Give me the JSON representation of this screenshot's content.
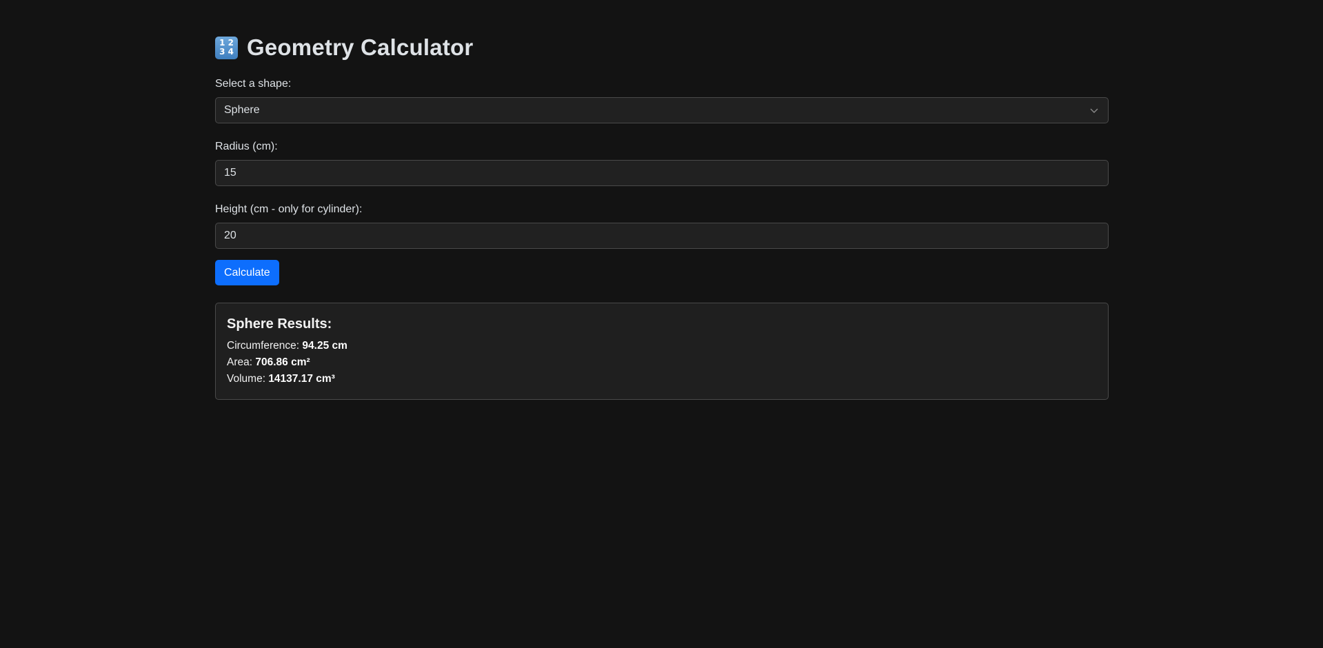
{
  "header": {
    "icon_digits": [
      "1",
      "2",
      "3",
      "4"
    ],
    "title": "Geometry Calculator"
  },
  "form": {
    "shape_label": "Select a shape:",
    "shape_selected": "Sphere",
    "radius_label": "Radius (cm):",
    "radius_value": "15",
    "height_label": "Height (cm - only for cylinder):",
    "height_value": "20",
    "calculate_label": "Calculate"
  },
  "results": {
    "title": "Sphere Results:",
    "circumference_label": "Circumference: ",
    "circumference_value": "94.25 cm",
    "area_label": "Area: ",
    "area_value": "706.86 cm²",
    "volume_label": "Volume: ",
    "volume_value": "14137.17 cm³"
  },
  "colors": {
    "background": "#131313",
    "accent": "#0d6efd",
    "panel": "#212121"
  }
}
